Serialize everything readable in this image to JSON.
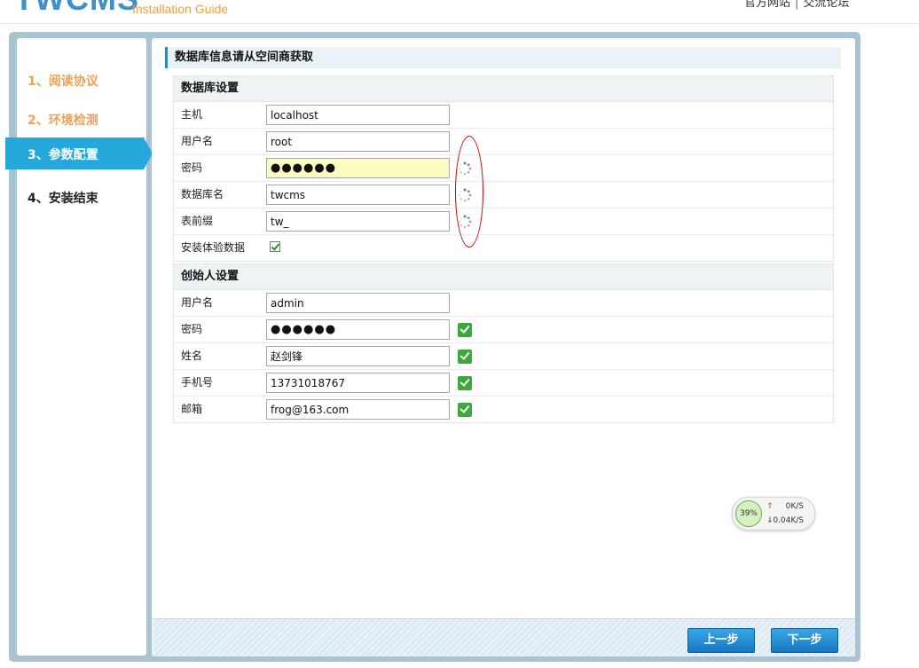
{
  "header": {
    "logo": "TWCMS",
    "subtitle": "Installation Guide",
    "links": [
      "官方网站",
      "交流论坛"
    ]
  },
  "sidebar": {
    "items": [
      {
        "label": "1、阅读协议",
        "state": "done"
      },
      {
        "label": "2、环境检测",
        "state": "done"
      },
      {
        "label": "3、参数配置",
        "state": "active"
      },
      {
        "label": "4、安装结束",
        "state": "pending"
      }
    ]
  },
  "page_title": "数据库信息请从空间商获取",
  "db_section": {
    "title": "数据库设置",
    "host_label": "主机",
    "host_value": "localhost",
    "user_label": "用户名",
    "user_value": "root",
    "pass_label": "密码",
    "pass_value": "●●●●●●",
    "dbname_label": "数据库名",
    "dbname_value": "twcms",
    "prefix_label": "表前缀",
    "prefix_value": "tw_",
    "demo_label": "安装体验数据"
  },
  "founder_section": {
    "title": "创始人设置",
    "user_label": "用户名",
    "user_value": "admin",
    "pass_label": "密码",
    "pass_value": "●●●●●●",
    "name_label": "姓名",
    "name_value": "赵剑锋",
    "mobile_label": "手机号",
    "mobile_value": "13731018767",
    "email_label": "邮箱",
    "email_value": "frog@163.com"
  },
  "speed_widget": {
    "percent": "39%",
    "up": "0K/S",
    "down": "0.04K/S"
  },
  "buttons": {
    "prev": "上一步",
    "next": "下一步"
  },
  "colors": {
    "accent": "#27a8dc",
    "done_step": "#f0a050",
    "ok_icon": "#3ea83e",
    "annotation": "#d00000"
  }
}
